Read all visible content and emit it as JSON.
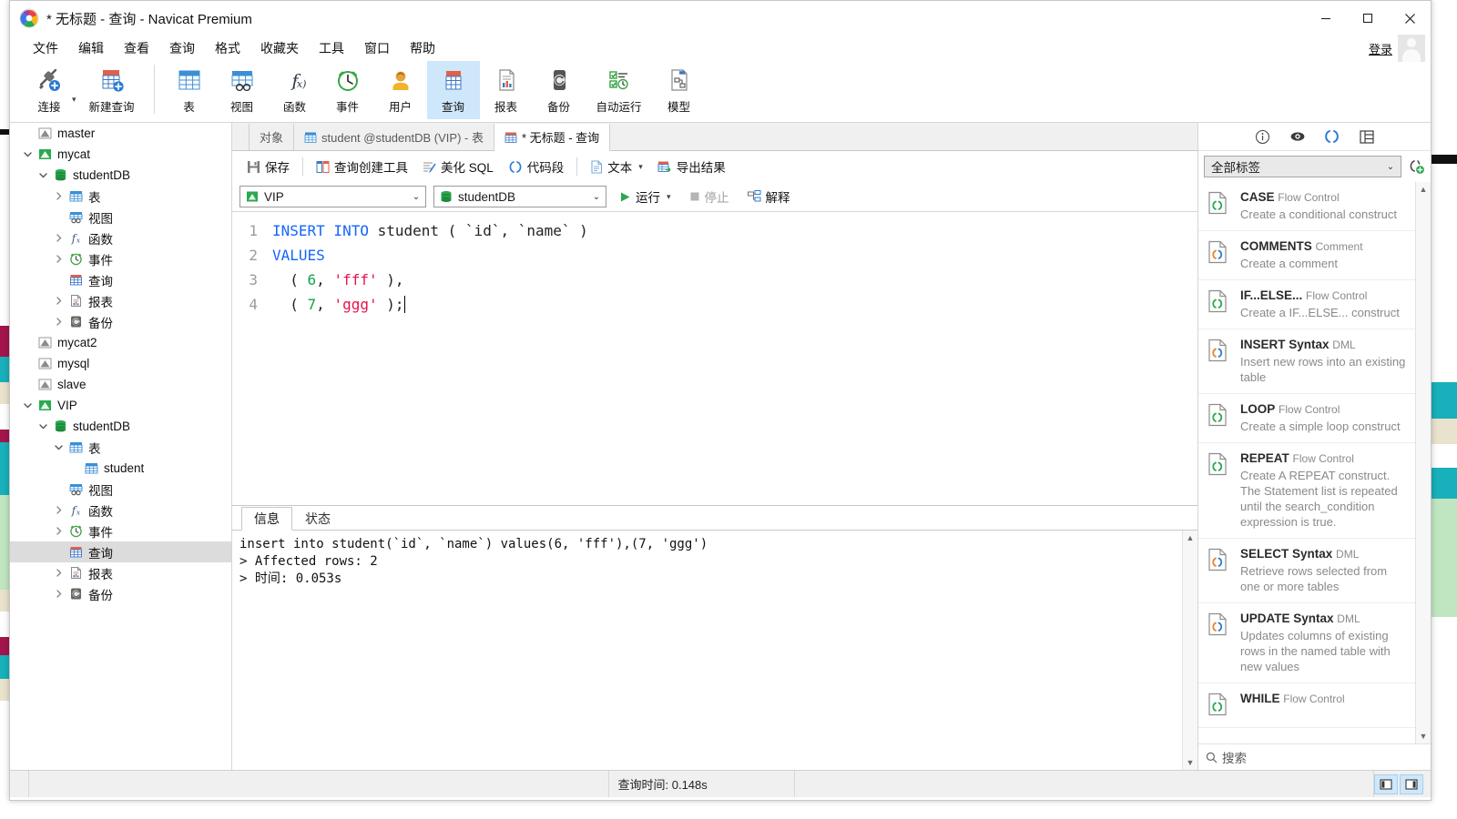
{
  "window": {
    "title": "* 无标题 - 查询 - Navicat Premium",
    "minimize": "minimize-icon",
    "maximize": "maximize-icon",
    "close": "close-icon"
  },
  "menubar": {
    "items": [
      "文件",
      "编辑",
      "查看",
      "查询",
      "格式",
      "收藏夹",
      "工具",
      "窗口",
      "帮助"
    ],
    "login_label": "登录"
  },
  "toolbar": {
    "items": [
      {
        "label": "连接",
        "icon": "connect-icon",
        "active": false
      },
      {
        "label": "新建查询",
        "icon": "new-query-icon",
        "active": false
      },
      {
        "label": "表",
        "icon": "table-icon",
        "active": false
      },
      {
        "label": "视图",
        "icon": "view-icon",
        "active": false
      },
      {
        "label": "函数",
        "icon": "function-icon",
        "active": false
      },
      {
        "label": "事件",
        "icon": "event-icon",
        "active": false
      },
      {
        "label": "用户",
        "icon": "user-icon",
        "active": false
      },
      {
        "label": "查询",
        "icon": "query-icon",
        "active": true
      },
      {
        "label": "报表",
        "icon": "report-icon",
        "active": false
      },
      {
        "label": "备份",
        "icon": "backup-icon",
        "active": false
      },
      {
        "label": "自动运行",
        "icon": "automation-icon",
        "active": false
      },
      {
        "label": "模型",
        "icon": "model-icon",
        "active": false
      }
    ]
  },
  "sidebar": {
    "rows": [
      {
        "label": "master",
        "indent": 0,
        "twisty": "none",
        "icon": "connection-gray-icon"
      },
      {
        "label": "mycat",
        "indent": 0,
        "twisty": "expanded",
        "icon": "connection-green-icon"
      },
      {
        "label": "studentDB",
        "indent": 1,
        "twisty": "expanded",
        "icon": "database-icon"
      },
      {
        "label": "表",
        "indent": 2,
        "twisty": "collapsed",
        "icon": "table-icon"
      },
      {
        "label": "视图",
        "indent": 2,
        "twisty": "none",
        "icon": "view-icon"
      },
      {
        "label": "函数",
        "indent": 2,
        "twisty": "collapsed",
        "icon": "function-icon"
      },
      {
        "label": "事件",
        "indent": 2,
        "twisty": "collapsed",
        "icon": "event-icon"
      },
      {
        "label": "查询",
        "indent": 2,
        "twisty": "none",
        "icon": "query-icon"
      },
      {
        "label": "报表",
        "indent": 2,
        "twisty": "collapsed",
        "icon": "report-icon"
      },
      {
        "label": "备份",
        "indent": 2,
        "twisty": "collapsed",
        "icon": "backup-icon"
      },
      {
        "label": "mycat2",
        "indent": 0,
        "twisty": "none",
        "icon": "connection-gray-icon"
      },
      {
        "label": "mysql",
        "indent": 0,
        "twisty": "none",
        "icon": "connection-gray-icon"
      },
      {
        "label": "slave",
        "indent": 0,
        "twisty": "none",
        "icon": "connection-gray-icon"
      },
      {
        "label": "VIP",
        "indent": 0,
        "twisty": "expanded",
        "icon": "connection-green-icon"
      },
      {
        "label": "studentDB",
        "indent": 1,
        "twisty": "expanded",
        "icon": "database-icon"
      },
      {
        "label": "表",
        "indent": 2,
        "twisty": "expanded",
        "icon": "table-icon"
      },
      {
        "label": "student",
        "indent": 3,
        "twisty": "none",
        "icon": "table-icon"
      },
      {
        "label": "视图",
        "indent": 2,
        "twisty": "none",
        "icon": "view-icon"
      },
      {
        "label": "函数",
        "indent": 2,
        "twisty": "collapsed",
        "icon": "function-icon"
      },
      {
        "label": "事件",
        "indent": 2,
        "twisty": "collapsed",
        "icon": "event-icon"
      },
      {
        "label": "查询",
        "indent": 2,
        "twisty": "none",
        "icon": "query-icon",
        "selected": true
      },
      {
        "label": "报表",
        "indent": 2,
        "twisty": "collapsed",
        "icon": "report-icon"
      },
      {
        "label": "备份",
        "indent": 2,
        "twisty": "collapsed",
        "icon": "backup-icon"
      }
    ]
  },
  "tabs": [
    {
      "label": "对象",
      "icon": "none",
      "active": false
    },
    {
      "label": "student @studentDB (VIP) - 表",
      "icon": "table-icon",
      "active": false
    },
    {
      "label": "* 无标题 - 查询",
      "icon": "query-icon",
      "active": true
    }
  ],
  "query_toolbar": {
    "save": "保存",
    "query_builder": "查询创建工具",
    "beautify_sql": "美化 SQL",
    "code_snippet": "代码段",
    "text": "文本",
    "export_result": "导出结果"
  },
  "connection_bar": {
    "connection": "VIP",
    "database": "studentDB",
    "run": "运行",
    "stop": "停止",
    "explain": "解释"
  },
  "editor": {
    "lines": [
      "1",
      "2",
      "3",
      "4"
    ],
    "code_lines": [
      [
        {
          "t": "INSERT INTO ",
          "c": "kw"
        },
        {
          "t": "student ( `id`, `name` )",
          "c": "pl"
        }
      ],
      [
        {
          "t": "VALUES",
          "c": "kw"
        }
      ],
      [
        {
          "t": "  ( ",
          "c": "pl"
        },
        {
          "t": "6",
          "c": "num"
        },
        {
          "t": ", ",
          "c": "pl"
        },
        {
          "t": "'fff'",
          "c": "str"
        },
        {
          "t": " ),",
          "c": "pl"
        }
      ],
      [
        {
          "t": "  ( ",
          "c": "pl"
        },
        {
          "t": "7",
          "c": "num"
        },
        {
          "t": ", ",
          "c": "pl"
        },
        {
          "t": "'ggg'",
          "c": "str"
        },
        {
          "t": " );",
          "c": "pl"
        }
      ]
    ]
  },
  "results": {
    "tabs": [
      {
        "label": "信息",
        "active": true
      },
      {
        "label": "状态",
        "active": false
      }
    ],
    "message": "insert into student(`id`, `name`) values(6, 'fff'),(7, 'ggg')\n> Affected rows: 2\n> 时间: 0.053s"
  },
  "right_dock": {
    "icons": [
      "info-icon",
      "eye-icon",
      "code-snippet-icon",
      "structure-icon"
    ],
    "tag_filter": "全部标签",
    "add_snippet": "add-snippet-icon",
    "search_placeholder": "搜索",
    "snippets": [
      {
        "name": "CASE",
        "category": "Flow Control",
        "desc": "Create a conditional construct",
        "icon": "snippet-green-icon"
      },
      {
        "name": "COMMENTS",
        "category": "Comment",
        "desc": "Create a comment",
        "icon": "snippet-orange-icon"
      },
      {
        "name": "IF...ELSE...",
        "category": "Flow Control",
        "desc": "Create a IF...ELSE... construct",
        "icon": "snippet-green-icon"
      },
      {
        "name": "INSERT Syntax",
        "category": "DML",
        "desc": "Insert new rows into an existing table",
        "icon": "snippet-orange-icon"
      },
      {
        "name": "LOOP",
        "category": "Flow Control",
        "desc": "Create a simple loop construct",
        "icon": "snippet-green-icon"
      },
      {
        "name": "REPEAT",
        "category": "Flow Control",
        "desc": "Create A REPEAT construct. The Statement list is repeated until the search_condition expression is true.",
        "icon": "snippet-green-icon"
      },
      {
        "name": "SELECT Syntax",
        "category": "DML",
        "desc": "Retrieve rows selected from one or more tables",
        "icon": "snippet-orange-icon"
      },
      {
        "name": "UPDATE Syntax",
        "category": "DML",
        "desc": "Updates columns of existing rows in the named table with new values",
        "icon": "snippet-orange-icon"
      },
      {
        "name": "WHILE",
        "category": "Flow Control",
        "desc": "",
        "icon": "snippet-green-icon"
      }
    ]
  },
  "statusbar": {
    "query_time": "查询时间: 0.148s",
    "left_panel_toggle": "left-panel-toggle-icon",
    "right_panel_toggle": "right-panel-toggle-icon"
  },
  "colors": {
    "accent": "#1565ff",
    "active_tool_bg": "#cfe7fa",
    "string": "#e8114b",
    "number": "#11a44a",
    "keyword": "#1565ff"
  }
}
